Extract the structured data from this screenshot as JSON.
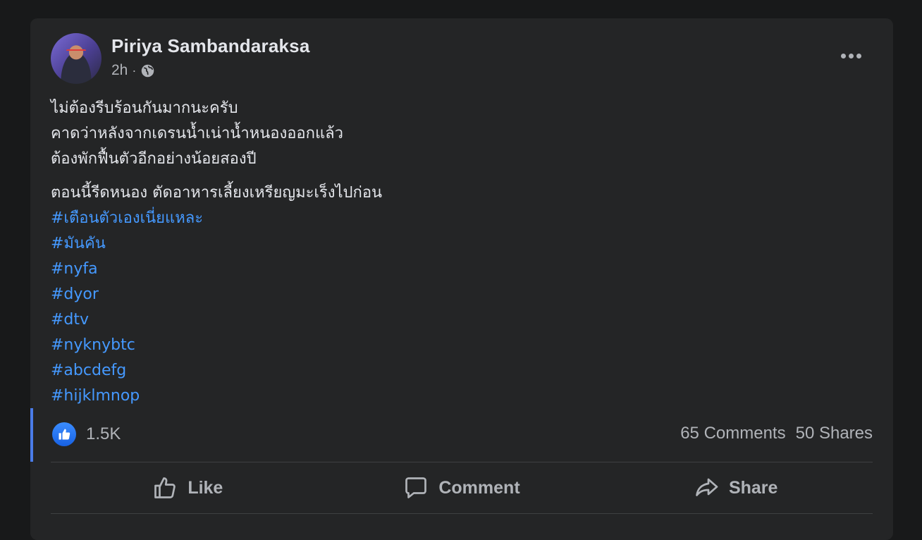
{
  "post": {
    "author": "Piriya Sambandaraksa",
    "time": "2h",
    "separator": "·",
    "paragraph1": [
      "ไม่ต้องรีบร้อนกันมากนะครับ",
      "คาดว่าหลังจากเดรนน้ำเน่าน้ำหนองออกแล้ว",
      "ต้องพักฟื้นตัวอีกอย่างน้อยสองปี"
    ],
    "paragraph2": "ตอนนี้รีดหนอง ตัดอาหารเลี้ยงเหรียญมะเร็งไปก่อน",
    "hashtags": [
      "#เตือนตัวเองเนี่ยแหละ",
      "#มันคัน",
      "#nyfa",
      "#dyor",
      "#dtv",
      "#nyknybtc",
      "#abcdefg",
      "#hijklmnop"
    ]
  },
  "stats": {
    "reactions": "1.5K",
    "comments": "65 Comments",
    "shares": "50 Shares"
  },
  "actions": {
    "like": "Like",
    "comment": "Comment",
    "share": "Share"
  },
  "colors": {
    "background": "#18191a",
    "card": "#242526",
    "text": "#e4e6eb",
    "secondary_text": "#b0b3b8",
    "hashtag": "#4599ff",
    "like_blue": "#1877f2"
  },
  "icons": [
    "globe-icon",
    "more-options-icon",
    "like-reaction-icon",
    "thumbs-up-icon",
    "comment-icon",
    "share-icon"
  ]
}
